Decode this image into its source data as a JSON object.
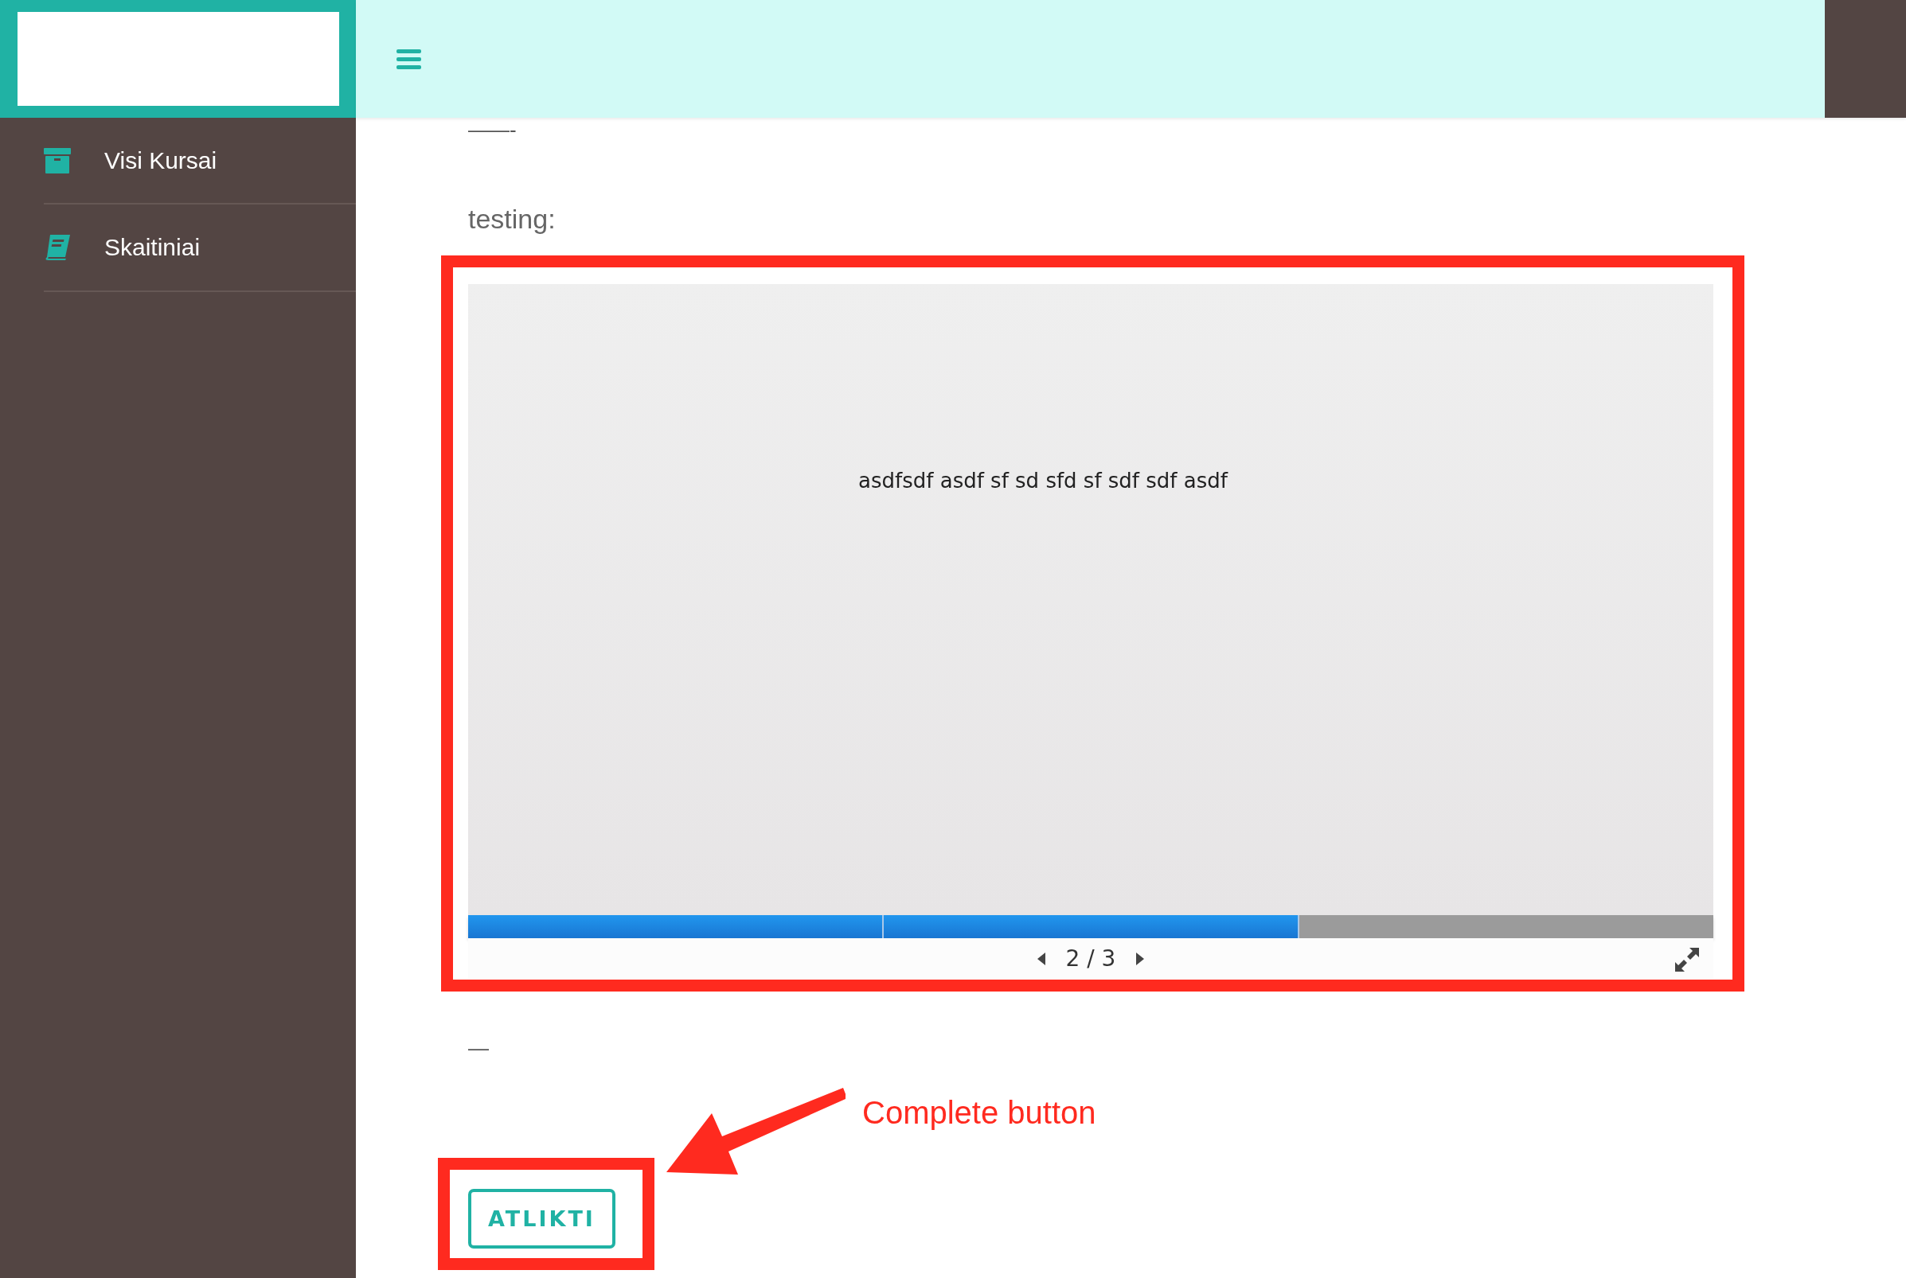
{
  "sidebar": {
    "items": [
      {
        "label": "Visi Kursai"
      },
      {
        "label": "Skaitiniai"
      }
    ]
  },
  "content": {
    "separator_top": "——-",
    "heading": "testing:",
    "separator_bottom": "—"
  },
  "slideshow": {
    "slide_text": "asdfsdf asdf sf sd sfd sf sdf sdf asdf",
    "segments": [
      {
        "complete": true
      },
      {
        "complete": true
      },
      {
        "complete": false
      }
    ],
    "page": "2 / 3"
  },
  "complete_button": {
    "label": "ATLIKTI"
  },
  "annotation": {
    "label": "Complete button"
  }
}
